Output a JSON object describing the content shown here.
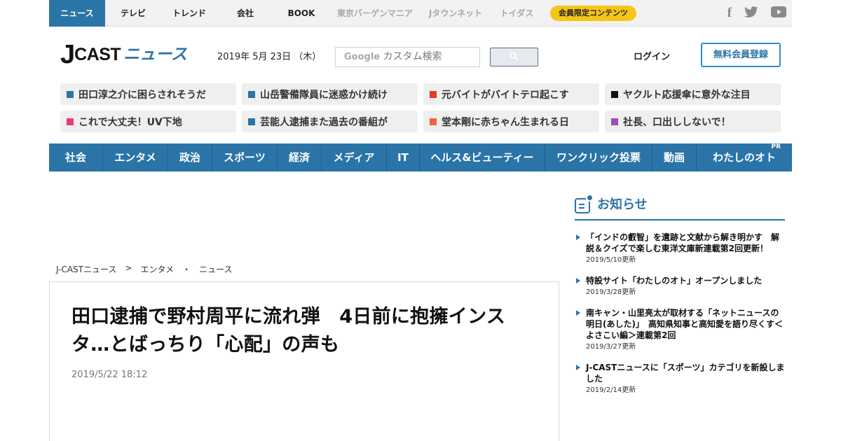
{
  "topnav": {
    "items": [
      {
        "label": "ニュース",
        "active": true
      },
      {
        "label": "テレビ"
      },
      {
        "label": "トレンド"
      },
      {
        "label": "会社"
      },
      {
        "label": "BOOK"
      },
      {
        "label": "東京バーゲンマニア",
        "muted": true
      },
      {
        "label": "Jタウンネット",
        "muted": true
      },
      {
        "label": "トイダス",
        "muted": true
      }
    ],
    "member_label": "会員限定コンテンツ",
    "social": {
      "facebook": "f",
      "twitter": "twitter-icon",
      "youtube": "youtube-icon"
    }
  },
  "header": {
    "logo_j": "J",
    "logo_cast": "CAST",
    "logo_news": "ニュース",
    "date": "2019年 5月 23日 （木）",
    "search_brand": "Google",
    "search_placeholder": "カスタム検索",
    "login_label": "ログイン",
    "register_label": "無料会員登録"
  },
  "headline_tags": [
    {
      "text": "田口淳之介に困らされそうだ",
      "color": "#2b74a8"
    },
    {
      "text": "山岳警備隊員に迷惑かけ続け",
      "color": "#2b74a8"
    },
    {
      "text": "元バイトがバイトテロ起こす",
      "color": "#e03a2a"
    },
    {
      "text": "ヤクルト応援傘に意外な注目",
      "color": "#111111"
    },
    {
      "text": "これで大丈夫！UV下地",
      "color": "#ec3a78"
    },
    {
      "text": "芸能人逮捕また過去の番組が",
      "color": "#2b74a8"
    },
    {
      "text": "堂本剛に赤ちゃん生まれる日",
      "color": "#f0653a"
    },
    {
      "text": "社長、口出ししないで！",
      "color": "#9a4fb5"
    }
  ],
  "categories": [
    {
      "label": "社会"
    },
    {
      "label": "エンタメ"
    },
    {
      "label": "政治"
    },
    {
      "label": "スポーツ"
    },
    {
      "label": "経済"
    },
    {
      "label": "メディア"
    },
    {
      "label": "IT"
    },
    {
      "label": "ヘルス&ビューティー"
    },
    {
      "label": "ワンクリック投票"
    },
    {
      "label": "動画"
    },
    {
      "label": "わたしのオト",
      "badge": "PR"
    }
  ],
  "breadcrumb": [
    "J-CASTニュース",
    ">",
    "エンタメ",
    "・",
    "ニュース"
  ],
  "article": {
    "title": "田口逮捕で野村周平に流れ弾　4日前に抱擁インスタ…とばっちり「心配」の声も",
    "timestamp": "2019/5/22 18:12"
  },
  "notices": {
    "heading": "お知らせ",
    "items": [
      {
        "text": "「インドの叡智」を遺跡と文献から解き明かす　解説＆クイズで楽しむ東洋文庫新連載第2回更新！",
        "date": "2019/5/10更新"
      },
      {
        "text": "特設サイト「わたしのオト」オープンしました",
        "date": "2019/3/28更新"
      },
      {
        "text": "南キャン・山里亮太が取材する「ネットニュースの明日(あした)」　高知県知事と高知愛を語り尽くす＜よさこい編＞連載第2回",
        "date": "2019/3/27更新"
      },
      {
        "text": "J-CASTニュースに「スポーツ」カテゴリを新設しました",
        "date": "2019/2/14更新"
      }
    ]
  },
  "colors": {
    "brand_blue": "#2b74a8",
    "member_yellow": "#f5c518"
  }
}
